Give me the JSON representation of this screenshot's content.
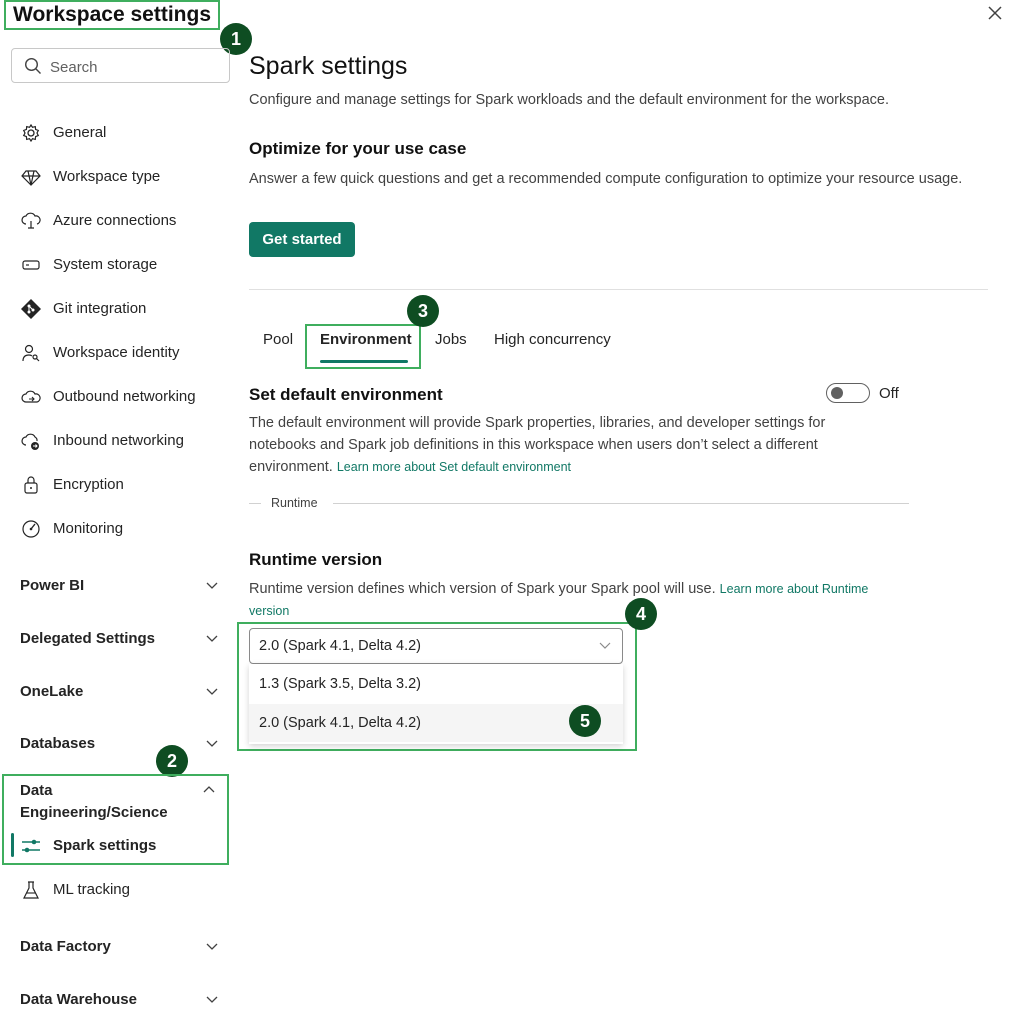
{
  "header": {
    "title": "Workspace settings",
    "close_label": "Close"
  },
  "annotations": [
    "1",
    "2",
    "3",
    "4",
    "5"
  ],
  "search": {
    "placeholder": "Search",
    "value": ""
  },
  "sidebar": {
    "items": [
      {
        "label": "General",
        "icon": "gear-icon"
      },
      {
        "label": "Workspace type",
        "icon": "diamond-icon"
      },
      {
        "label": "Azure connections",
        "icon": "cloud-link-icon"
      },
      {
        "label": "System storage",
        "icon": "storage-icon"
      },
      {
        "label": "Git integration",
        "icon": "git-icon"
      },
      {
        "label": "Workspace identity",
        "icon": "person-key-icon"
      },
      {
        "label": "Outbound networking",
        "icon": "cloud-arrow-out-icon"
      },
      {
        "label": "Inbound networking",
        "icon": "cloud-arrow-in-icon"
      },
      {
        "label": "Encryption",
        "icon": "lock-icon"
      },
      {
        "label": "Monitoring",
        "icon": "gauge-icon"
      }
    ],
    "sections": [
      {
        "label": "Power BI",
        "expanded": false
      },
      {
        "label": "Delegated Settings",
        "expanded": false
      },
      {
        "label": "OneLake",
        "expanded": false
      },
      {
        "label": "Databases",
        "expanded": false
      },
      {
        "label": "Data Engineering/Science",
        "expanded": true
      },
      {
        "label": "Data Factory",
        "expanded": false
      },
      {
        "label": "Data Warehouse",
        "expanded": false
      }
    ],
    "sub_items": [
      {
        "label": "Spark settings",
        "icon": "sliders-icon",
        "active": true
      },
      {
        "label": "ML tracking",
        "icon": "flask-icon",
        "active": false
      }
    ]
  },
  "main": {
    "title": "Spark settings",
    "description": "Configure and manage settings for Spark workloads and the default environment for the workspace.",
    "optimize": {
      "title": "Optimize for your use case",
      "description": "Answer a few quick questions and get a recommended compute configuration to optimize your resource usage.",
      "button": "Get started"
    },
    "tabs": [
      {
        "label": "Pool",
        "active": false
      },
      {
        "label": "Environment",
        "active": true
      },
      {
        "label": "Jobs",
        "active": false
      },
      {
        "label": "High concurrency",
        "active": false
      }
    ],
    "default_env": {
      "title": "Set default environment",
      "toggle_label": "Off",
      "toggle_on": false,
      "description": "The default environment will provide Spark properties, libraries, and developer settings for notebooks and Spark job definitions in this workspace when users don’t select a different environment.",
      "link": "Learn more about Set default environment"
    },
    "runtime_divider": "Runtime",
    "runtime": {
      "title": "Runtime version",
      "description": "Runtime version defines which version of Spark your Spark pool will use.",
      "link": "Learn more about Runtime version",
      "selected": "2.0 (Spark 4.1, Delta 4.2)",
      "options": [
        "1.3 (Spark 3.5, Delta 3.2)",
        "2.0 (Spark 4.1, Delta 4.2)"
      ]
    }
  },
  "colors": {
    "accent": "#117865",
    "highlight": "#3fae5e",
    "badge": "#0e4d22"
  }
}
